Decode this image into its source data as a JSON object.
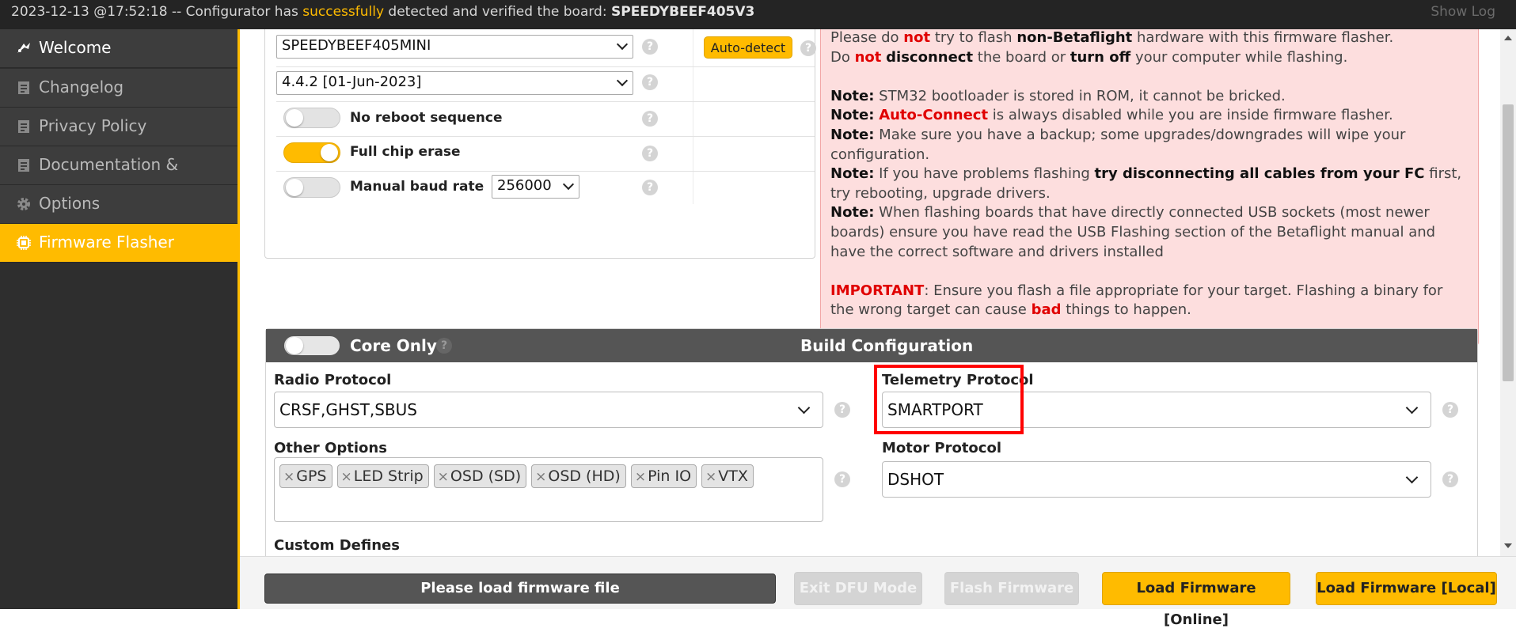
{
  "log": {
    "prefix": "2023-12-13 @17:52:18 -- Configurator has ",
    "success": "successfully",
    "middle": " detected and verified the board: ",
    "board": "SPEEDYBEEF405V3",
    "show_log": "Show Log"
  },
  "sidebar": {
    "items": [
      {
        "label": "Welcome",
        "icon": "welcome-icon"
      },
      {
        "label": "Changelog",
        "icon": "document-icon"
      },
      {
        "label": "Privacy Policy",
        "icon": "document-icon"
      },
      {
        "label": "Documentation & Support",
        "icon": "document-icon"
      },
      {
        "label": "Options",
        "icon": "gear-icon"
      },
      {
        "label": "Firmware Flasher",
        "icon": "chip-icon"
      }
    ],
    "active": "Firmware Flasher"
  },
  "flasher": {
    "board_select": "SPEEDYBEEF405MINI",
    "auto_detect": "Auto-detect",
    "version_select": "4.4.2 [01-Jun-2023]",
    "options": {
      "no_reboot": {
        "label": "No reboot sequence",
        "on": false
      },
      "full_chip_erase": {
        "label": "Full chip erase",
        "on": true
      },
      "manual_baud": {
        "label": "Manual baud rate",
        "on": false,
        "value": "256000"
      }
    }
  },
  "warning": {
    "l1a": "Please do ",
    "l1b": "not",
    "l1c": " try to flash ",
    "l1d": "non-Betaflight",
    "l1e": " hardware with this firmware flasher.",
    "l2a": "Do ",
    "l2b": "not",
    "l2c": " ",
    "l2d": "disconnect",
    "l2e": " the board or ",
    "l2f": "turn off",
    "l2g": " your computer while flashing.",
    "note": "Note:",
    "n1": " STM32 bootloader is stored in ROM, it cannot be bricked.",
    "n2a": " ",
    "n2b": "Auto-Connect",
    "n2c": " is always disabled while you are inside firmware flasher.",
    "n3": " Make sure you have a backup; some upgrades/downgrades will wipe your configuration.",
    "n4a": " If you have problems flashing ",
    "n4b": "try disconnecting all cables from your FC",
    "n4c": " first, try rebooting, upgrade drivers.",
    "n5": " When flashing boards that have directly connected USB sockets (most newer boards) ensure you have read the USB Flashing section of the Betaflight manual and have the correct software and drivers installed",
    "imp": "IMPORTANT",
    "imp_a": ": Ensure you flash a file appropriate for your target. Flashing a binary for the wrong target can cause ",
    "imp_b": "bad",
    "imp_c": " things to happen."
  },
  "build": {
    "core_only": "Core Only",
    "title": "Build Configuration",
    "radio_label": "Radio Protocol",
    "radio_value": "CRSF,GHST,SBUS",
    "telemetry_label": "Telemetry Protocol",
    "telemetry_value": "SMARTPORT",
    "other_label": "Other Options",
    "other_tags": [
      "GPS",
      "LED Strip",
      "OSD (SD)",
      "OSD (HD)",
      "Pin IO",
      "VTX"
    ],
    "motor_label": "Motor Protocol",
    "motor_value": "DSHOT",
    "custom_label": "Custom Defines"
  },
  "footer": {
    "progress": "Please load firmware file",
    "exit_dfu": "Exit DFU Mode",
    "flash": "Flash Firmware",
    "load_online": "Load Firmware [Online]",
    "load_local": "Load Firmware [Local]"
  },
  "colors": {
    "accent": "#ffbb00",
    "highlight": "#ff0000",
    "warn_bg": "#fddede",
    "warn_red": "#e00000"
  }
}
